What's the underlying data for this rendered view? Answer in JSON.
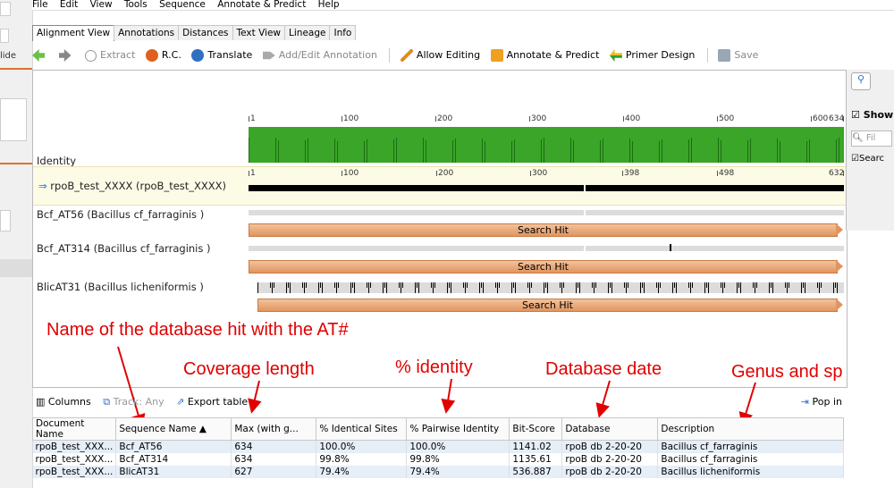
{
  "sidebar_partial": {
    "label": "lide"
  },
  "menu": [
    "File",
    "Edit",
    "View",
    "Tools",
    "Sequence",
    "Annotate & Predict",
    "Help"
  ],
  "tabs": [
    "Alignment View",
    "Annotations",
    "Distances",
    "Text View",
    "Lineage",
    "Info"
  ],
  "toolbar": {
    "back_icon": "back-arrow-icon",
    "forward_icon": "forward-arrow-icon",
    "extract": "Extract",
    "rc": "R.C.",
    "translate": "Translate",
    "add_edit_annotation": "Add/Edit Annotation",
    "allow_editing": "Allow Editing",
    "annotate_predict": "Annotate & Predict",
    "primer_design": "Primer Design",
    "save": "Save"
  },
  "alignment": {
    "identity_label": "Identity",
    "identity_ticks": [
      "1",
      "100",
      "200",
      "300",
      "400",
      "500",
      "600",
      "634"
    ],
    "query_label": "rpoB_test_XXXX (rpoB_test_XXXX)",
    "query_ticks": [
      "1",
      "100",
      "200",
      "300",
      "398",
      "498",
      "632"
    ],
    "hits": [
      {
        "label": "Bcf_AT56 (Bacillus cf_farraginis )",
        "bar": "Search Hit"
      },
      {
        "label": "Bcf_AT314 (Bacillus cf_farraginis )",
        "bar": "Search Hit"
      },
      {
        "label": "BlicAT31 (Bacillus licheniformis )",
        "bar": "Search Hit"
      }
    ]
  },
  "right_panel": {
    "show": "Show",
    "filter": "Fil",
    "search": "Searc"
  },
  "annotations": {
    "name_hit": "Name of the database hit with the AT#",
    "coverage": "Coverage length",
    "identity": "% identity",
    "db_date": "Database date",
    "genus": "Genus and sp"
  },
  "table_toolbar": {
    "columns": "Columns",
    "track": "Track: Any",
    "export": "Export table",
    "popin": "Pop in"
  },
  "table": {
    "headers": [
      "Document Name",
      "Sequence Name ▲",
      "Max (with g...",
      "% Identical Sites",
      "% Pairwise Identity",
      "Bit-Score",
      "Database",
      "Description"
    ],
    "rows": [
      [
        "rpoB_test_XXX...",
        "Bcf_AT56",
        "634",
        "100.0%",
        "100.0%",
        "1141.02",
        "rpoB db 2-20-20",
        "Bacillus cf_farraginis"
      ],
      [
        "rpoB_test_XXX...",
        "Bcf_AT314",
        "634",
        "99.8%",
        "99.8%",
        "1135.61",
        "rpoB db 2-20-20",
        "Bacillus cf_farraginis"
      ],
      [
        "rpoB_test_XXX...",
        "BlicAT31",
        "627",
        "79.4%",
        "79.4%",
        "536.887",
        "rpoB db 2-20-20",
        "Bacillus licheniformis"
      ]
    ]
  }
}
